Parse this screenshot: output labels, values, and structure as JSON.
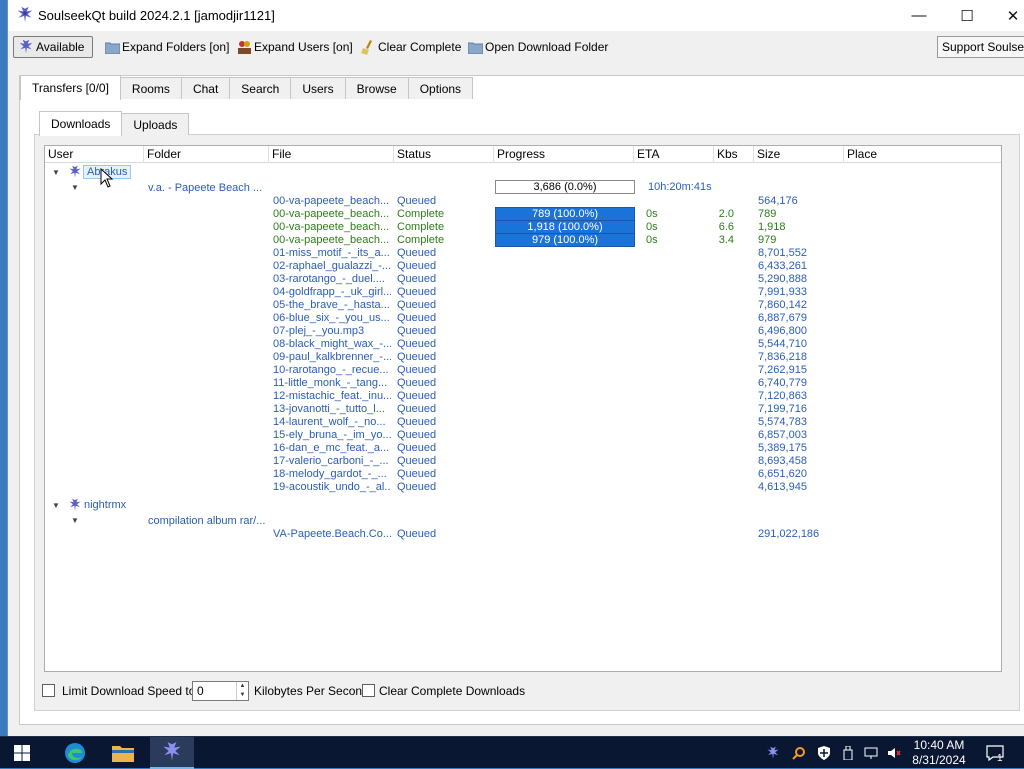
{
  "window": {
    "title": "SoulseekQt build 2024.2.1 [jamodjir1121]"
  },
  "toolbar": {
    "available": "Available",
    "expand_folders": "Expand Folders [on]",
    "expand_users": "Expand Users [on]",
    "clear_complete": "Clear Complete",
    "open_download_folder": "Open Download Folder",
    "support": "Support Soulseek"
  },
  "tabs": [
    "Transfers [0/0]",
    "Rooms",
    "Chat",
    "Search",
    "Users",
    "Browse",
    "Options"
  ],
  "subtabs": [
    "Downloads",
    "Uploads"
  ],
  "columns": [
    "User",
    "Folder",
    "File",
    "Status",
    "Progress",
    "ETA",
    "Kbs",
    "Size",
    "Place"
  ],
  "groups": [
    {
      "user": "Abrakus",
      "folder": "v.a. - Papeete Beach ...",
      "summary": {
        "progress": "3,686 (0.0%)",
        "eta": "10h:20m:41s"
      },
      "files": [
        {
          "file": "00-va-papeete_beach...",
          "status": "Queued",
          "size": "564,176"
        },
        {
          "file": "00-va-papeete_beach...",
          "status": "Complete",
          "progress": "789 (100.0%)",
          "fraction": 1.0,
          "eta": "0s",
          "kbs": "2.0",
          "size": "789"
        },
        {
          "file": "00-va-papeete_beach...",
          "status": "Complete",
          "progress": "1,918 (100.0%)",
          "fraction": 1.0,
          "eta": "0s",
          "kbs": "6.6",
          "size": "1,918"
        },
        {
          "file": "00-va-papeete_beach...",
          "status": "Complete",
          "progress": "979 (100.0%)",
          "fraction": 1.0,
          "eta": "0s",
          "kbs": "3.4",
          "size": "979"
        },
        {
          "file": "01-miss_motif_-_its_a...",
          "status": "Queued",
          "size": "8,701,552"
        },
        {
          "file": "02-raphael_gualazzi_-...",
          "status": "Queued",
          "size": "6,433,261"
        },
        {
          "file": "03-rarotango_-_duel....",
          "status": "Queued",
          "size": "5,290,888"
        },
        {
          "file": "04-goldfrapp_-_uk_girl...",
          "status": "Queued",
          "size": "7,991,933"
        },
        {
          "file": "05-the_brave_-_hasta...",
          "status": "Queued",
          "size": "7,860,142"
        },
        {
          "file": "06-blue_six_-_you_us...",
          "status": "Queued",
          "size": "6,887,679"
        },
        {
          "file": "07-plej_-_you.mp3",
          "status": "Queued",
          "size": "6,496,800"
        },
        {
          "file": "08-black_might_wax_-...",
          "status": "Queued",
          "size": "5,544,710"
        },
        {
          "file": "09-paul_kalkbrenner_-...",
          "status": "Queued",
          "size": "7,836,218"
        },
        {
          "file": "10-rarotango_-_recue...",
          "status": "Queued",
          "size": "7,262,915"
        },
        {
          "file": "11-little_monk_-_tang...",
          "status": "Queued",
          "size": "6,740,779"
        },
        {
          "file": "12-mistachic_feat._inu...",
          "status": "Queued",
          "size": "7,120,863"
        },
        {
          "file": "13-jovanotti_-_tutto_l...",
          "status": "Queued",
          "size": "7,199,716"
        },
        {
          "file": "14-laurent_wolf_-_no...",
          "status": "Queued",
          "size": "5,574,783"
        },
        {
          "file": "15-ely_bruna_-_im_yo...",
          "status": "Queued",
          "size": "6,857,003"
        },
        {
          "file": "16-dan_e_mc_feat._a...",
          "status": "Queued",
          "size": "5,389,175"
        },
        {
          "file": "17-valerio_carboni_-_...",
          "status": "Queued",
          "size": "8,693,458"
        },
        {
          "file": "18-melody_gardot_-_...",
          "status": "Queued",
          "size": "6,651,620"
        },
        {
          "file": "19-acoustik_undo_-_al...",
          "status": "Queued",
          "size": "4,613,945"
        }
      ]
    },
    {
      "user": "nightrmx",
      "folder": "compilation album rar/...",
      "files": [
        {
          "file": "VA-Papeete.Beach.Co...",
          "status": "Queued",
          "size": "291,022,186"
        }
      ]
    }
  ],
  "bottom": {
    "limit_speed": "Limit Download Speed to",
    "speed_value": "0",
    "units": "Kilobytes Per Second",
    "clear_complete": "Clear Complete Downloads"
  },
  "clock": {
    "time": "10:40 AM",
    "date": "8/31/2024"
  },
  "notifications": "1",
  "colors": {
    "queued": "#2a5db8",
    "complete": "#2e7d1a",
    "progress_fill": "#1a73d9"
  }
}
